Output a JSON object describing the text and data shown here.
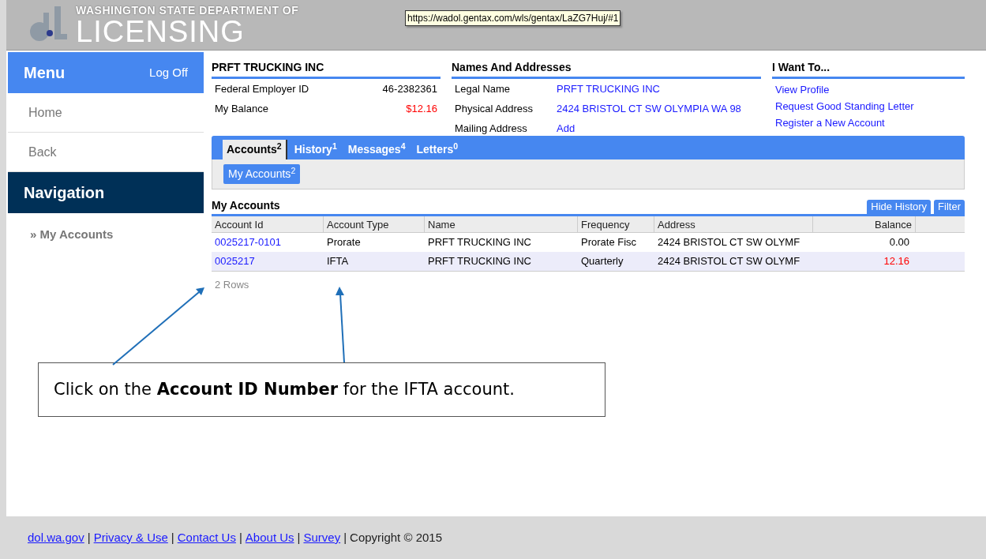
{
  "header": {
    "agency_line": "WASHINGTON STATE DEPARTMENT OF",
    "agency_name": "LICENSING",
    "tooltip": "https://wadol.gentax.com/wls/gentax/LaZG7Huj/#1"
  },
  "sidebar": {
    "menu_title": "Menu",
    "log_off": "Log Off",
    "items": [
      {
        "label": "Home"
      },
      {
        "label": "Back"
      }
    ],
    "nav_title": "Navigation",
    "nav_items": [
      {
        "marker": "»",
        "label": "My Accounts"
      }
    ]
  },
  "summary": {
    "title": "PRFT TRUCKING INC",
    "rows": [
      {
        "label": "Federal Employer ID",
        "value": "46-2382361",
        "balance_due": false
      },
      {
        "label": "My Balance",
        "value": "$12.16",
        "balance_due": true
      }
    ]
  },
  "names_addresses": {
    "title": "Names And Addresses",
    "rows": [
      {
        "label": "Legal Name",
        "value": "PRFT TRUCKING INC"
      },
      {
        "label": "Physical Address",
        "value": "2424 BRISTOL CT SW OLYMPIA WA 98"
      },
      {
        "label": "Mailing Address",
        "value": "Add"
      }
    ]
  },
  "i_want_to": {
    "title": "I Want To...",
    "links": [
      "View Profile",
      "Request Good Standing Letter",
      "Register a New Account"
    ]
  },
  "tabs": [
    {
      "label": "Accounts",
      "count": "2",
      "selected": true
    },
    {
      "label": "History",
      "count": "1",
      "selected": false
    },
    {
      "label": "Messages",
      "count": "4",
      "selected": false
    },
    {
      "label": "Letters",
      "count": "0",
      "selected": false
    }
  ],
  "subtabs": [
    {
      "label": "My Accounts",
      "count": "2",
      "selected": true
    }
  ],
  "accounts": {
    "title": "My Accounts",
    "buttons": [
      "Hide History",
      "Filter"
    ],
    "columns": [
      "Account Id",
      "Account Type",
      "Name",
      "Frequency",
      "Address",
      "Balance"
    ],
    "rows": [
      {
        "account_id": "0025217-0101",
        "account_type": "Prorate",
        "name": "PRFT TRUCKING INC",
        "frequency": "Prorate Fisc",
        "address": "2424 BRISTOL CT SW OLYMF",
        "balance": "0.00",
        "balance_due": false,
        "selected": false
      },
      {
        "account_id": "0025217",
        "account_type": "IFTA",
        "name": "PRFT TRUCKING INC",
        "frequency": "Quarterly",
        "address": "2424 BRISTOL CT SW OLYMF",
        "balance": "12.16",
        "balance_due": true,
        "selected": true
      }
    ],
    "row_count": "2 Rows"
  },
  "callout": {
    "text": "Click on the **Account ID Number** for the IFTA account."
  },
  "footer": {
    "separator": "|",
    "links": [
      "dol.wa.gov",
      "Privacy & Use",
      "Contact Us",
      "About Us",
      "Survey"
    ],
    "copyright": "Copyright © 2015"
  }
}
